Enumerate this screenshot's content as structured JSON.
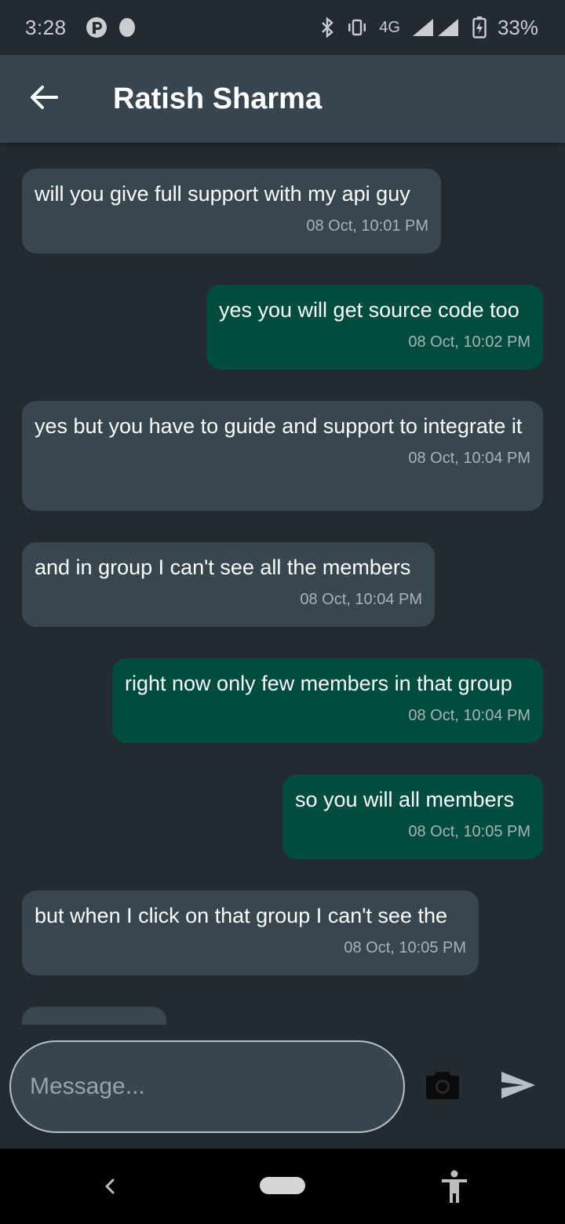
{
  "status_bar": {
    "time": "3:28",
    "network": "4G",
    "battery": "33%",
    "icons": [
      "sim-icon",
      "dot-icon",
      "bluetooth-icon",
      "vibrate-icon",
      "signal-icon",
      "battery-charging-icon"
    ]
  },
  "header": {
    "title": "Ratish Sharma",
    "back_icon": "arrow-back-icon"
  },
  "messages": [
    {
      "direction": "received",
      "text": "will you give full support with my api guy",
      "time": "08 Oct, 10:01 PM"
    },
    {
      "direction": "sent",
      "text": "yes you will get source code too",
      "time": "08 Oct, 10:02 PM"
    },
    {
      "direction": "received",
      "text": "yes but you have to guide and support to integrate it",
      "time": "08 Oct, 10:04 PM"
    },
    {
      "direction": "received",
      "text": "and in group I can't see all the members",
      "time": "08 Oct, 10:04 PM"
    },
    {
      "direction": "sent",
      "text": "right now only few members in that group",
      "time": "08 Oct, 10:04 PM"
    },
    {
      "direction": "sent",
      "text": "so you will all members",
      "time": "08 Oct, 10:05 PM"
    },
    {
      "direction": "received",
      "text": "but when I click on that group I can't see the",
      "time": "08 Oct, 10:05 PM"
    }
  ],
  "composer": {
    "placeholder": "Message...",
    "camera_icon": "camera-icon",
    "send_icon": "send-icon"
  },
  "colors": {
    "background": "#232a30",
    "app_bar": "#36454f",
    "received_bubble": "#37464f",
    "sent_bubble": "#004d40"
  }
}
